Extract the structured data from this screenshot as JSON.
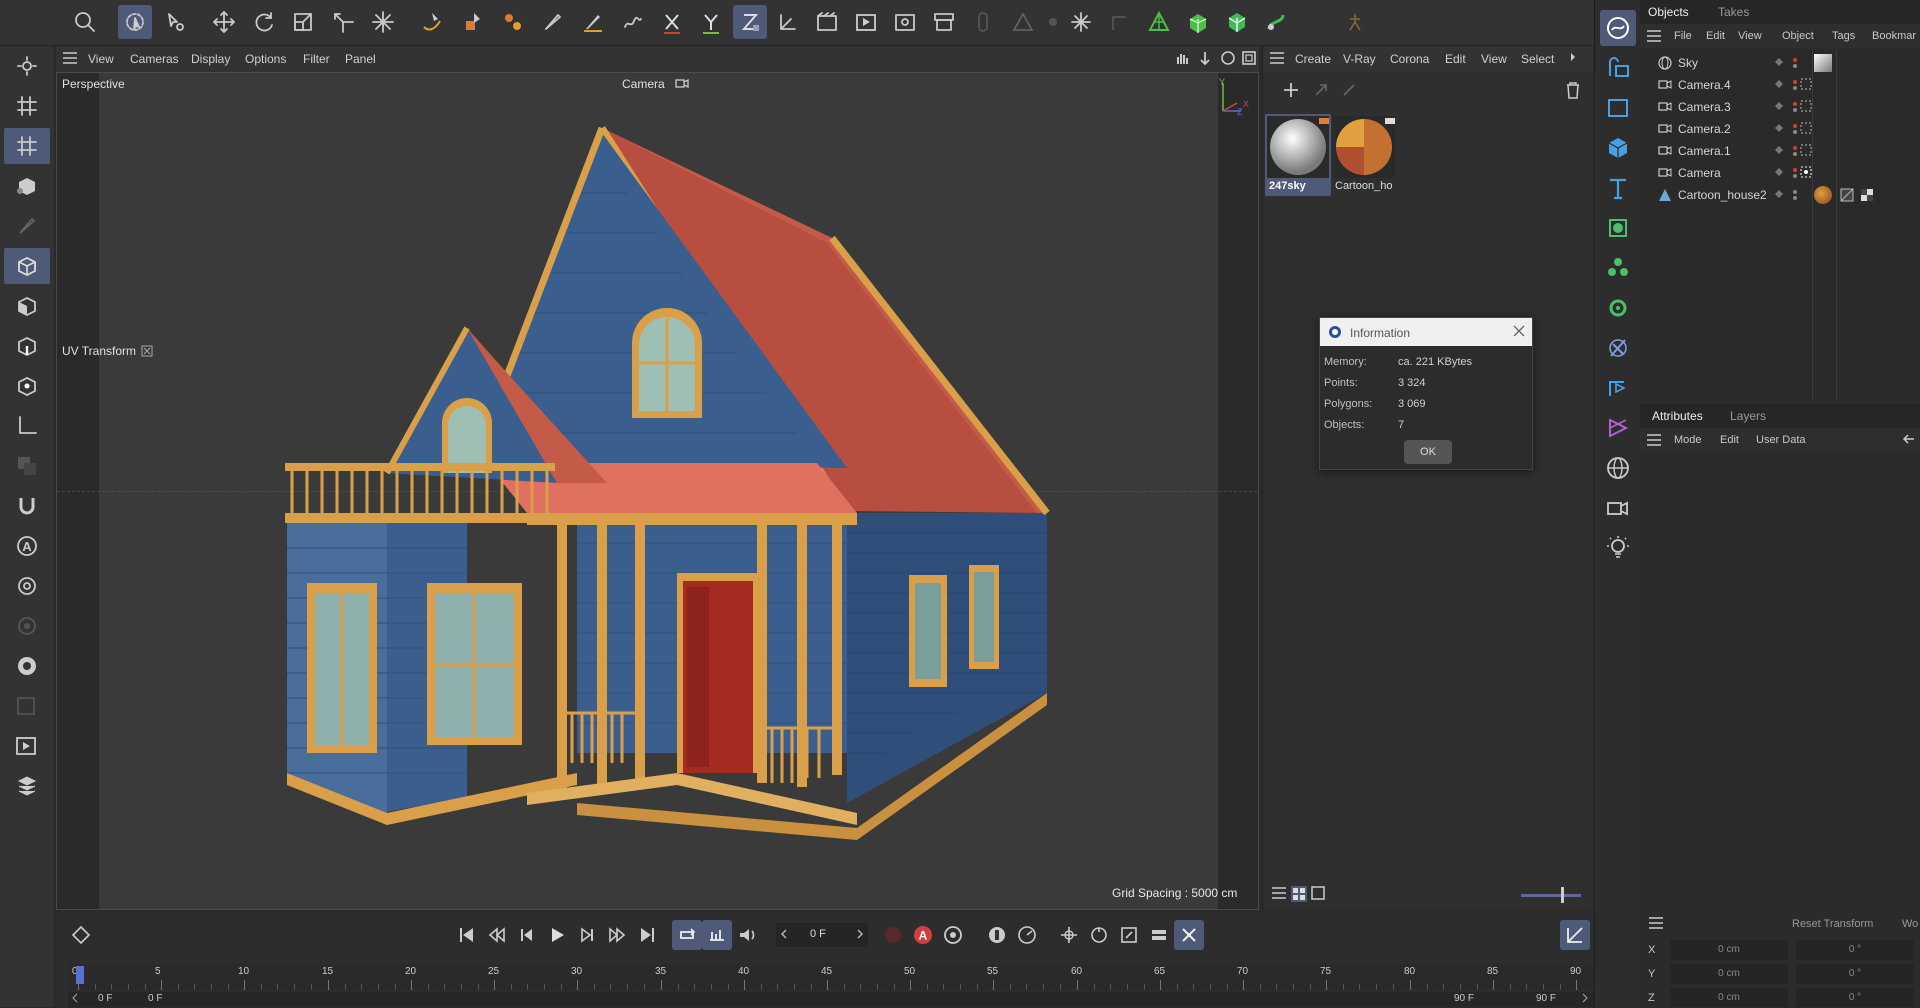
{
  "viewport": {
    "menu": [
      "View",
      "Cameras",
      "Display",
      "Options",
      "Filter",
      "Panel"
    ],
    "view_name": "Perspective",
    "camera_label": "Camera",
    "uv_transform": "UV Transform",
    "grid_spacing": "Grid Spacing : 5000 cm",
    "axis_y": "Y",
    "axis_x": "X",
    "axis_z": "Z"
  },
  "material_manager": {
    "menu": [
      "Create",
      "V-Ray",
      "Corona",
      "Edit",
      "View",
      "Select"
    ],
    "materials": [
      {
        "name": "247sky",
        "selected": true
      },
      {
        "name": "Cartoon_ho",
        "selected": false
      }
    ]
  },
  "objects_panel": {
    "tabs": [
      "Objects",
      "Takes"
    ],
    "menu": [
      "File",
      "Edit",
      "View",
      "Object",
      "Tags",
      "Bookmar"
    ],
    "items": [
      {
        "name": "Sky",
        "icon": "sky-icon"
      },
      {
        "name": "Camera.4",
        "icon": "camera-icon"
      },
      {
        "name": "Camera.3",
        "icon": "camera-icon"
      },
      {
        "name": "Camera.2",
        "icon": "camera-icon"
      },
      {
        "name": "Camera.1",
        "icon": "camera-icon"
      },
      {
        "name": "Camera",
        "icon": "camera-icon"
      },
      {
        "name": "Cartoon_house2",
        "icon": "mesh-icon"
      }
    ]
  },
  "attributes_panel": {
    "tabs": [
      "Attributes",
      "Layers"
    ],
    "menu": [
      "Mode",
      "Edit",
      "User Data"
    ]
  },
  "coordinates": {
    "reset_label": "Reset Transform",
    "extra_label": "Wo",
    "rows": [
      {
        "axis": "X",
        "pos": "0 cm",
        "rot": "0 °"
      },
      {
        "axis": "Y",
        "pos": "0 cm",
        "rot": "0 °"
      },
      {
        "axis": "Z",
        "pos": "0 cm",
        "rot": "0 °"
      }
    ]
  },
  "dialog": {
    "title": "Information",
    "rows": [
      {
        "label": "Memory:",
        "value": "ca. 221 KBytes"
      },
      {
        "label": "Points:",
        "value": "3 324"
      },
      {
        "label": "Polygons:",
        "value": "3 069"
      },
      {
        "label": "Objects:",
        "value": "7"
      }
    ],
    "ok": "OK"
  },
  "timeline": {
    "current_frame": "0 F",
    "start_frame": "0 F",
    "preview_start": "0 F",
    "preview_end": "90 F",
    "end_frame": "90 F",
    "ruler_labels": [
      "0",
      "5",
      "10",
      "15",
      "20",
      "25",
      "30",
      "35",
      "40",
      "45",
      "50",
      "55",
      "60",
      "65",
      "70",
      "75",
      "80",
      "85",
      "90"
    ]
  },
  "colors": {
    "accent": "#4f5a78",
    "wall_blue": "#3a5f8e",
    "roof_red": "#c45a48",
    "trim_gold": "#d9a049",
    "door_red": "#a52a22"
  }
}
